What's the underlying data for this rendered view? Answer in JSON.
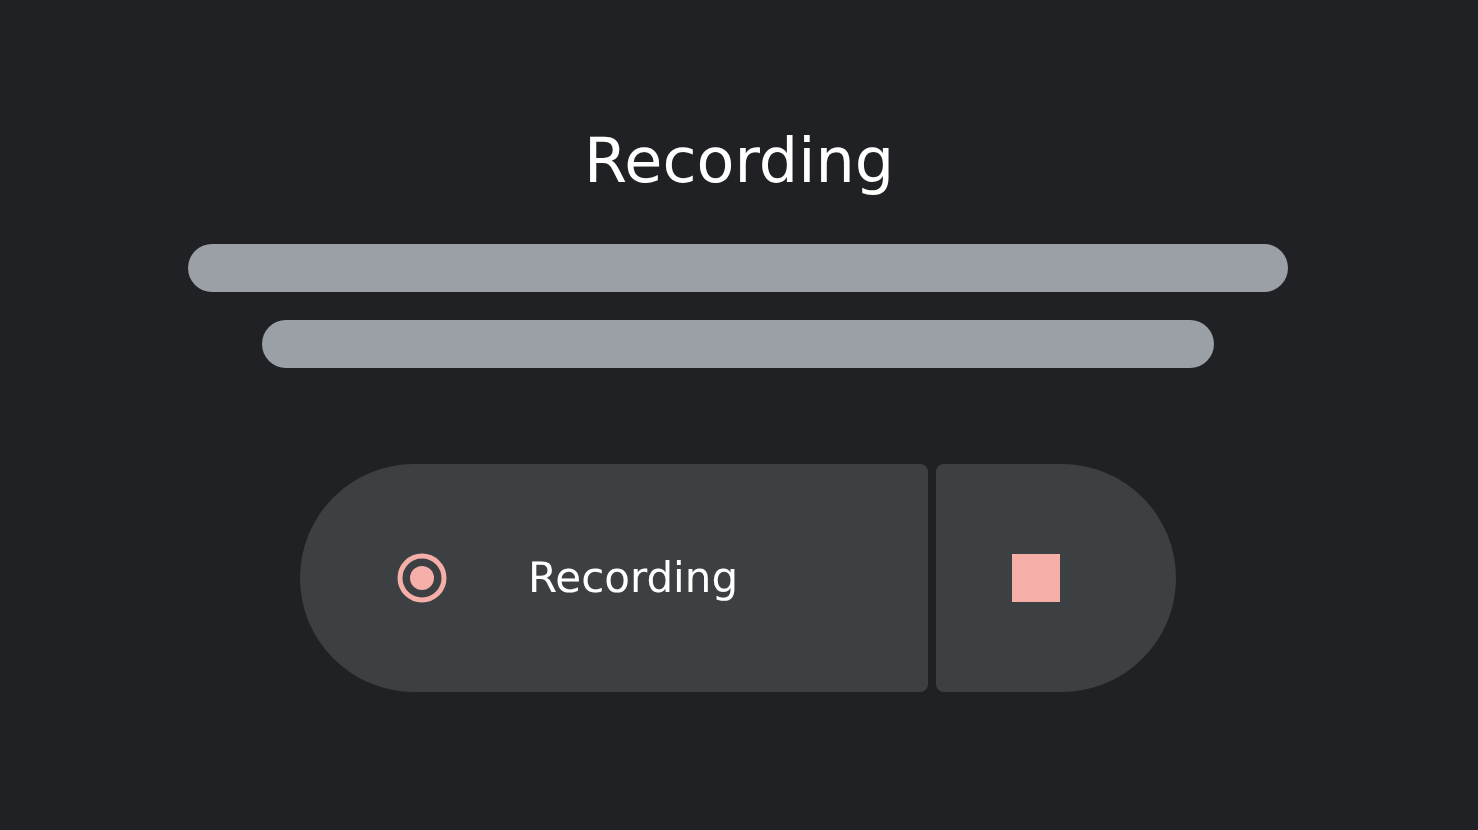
{
  "title": "Recording",
  "record_button": {
    "label": "Recording"
  }
}
